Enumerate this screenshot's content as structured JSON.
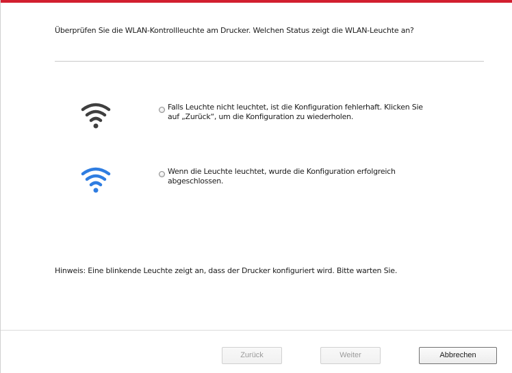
{
  "dialog": {
    "question": "Überprüfen Sie die WLAN-Kontrollleuchte am Drucker. Welchen Status zeigt die WLAN-Leuchte an?",
    "options": [
      {
        "icon": "wifi-off-icon",
        "icon_color": "#3f3f3f",
        "text": "Falls Leuchte nicht leuchtet, ist die Konfiguration fehlerhaft. Klicken Sie auf „Zurück“, um die Konfiguration zu wiederholen."
      },
      {
        "icon": "wifi-on-icon",
        "icon_color": "#2f7de1",
        "text": "Wenn die Leuchte leuchtet, wurde die Konfiguration erfolgreich abgeschlossen."
      }
    ],
    "hint": "Hinweis:  Eine blinkende Leuchte zeigt an, dass der Drucker konfiguriert wird.  Bitte warten Sie."
  },
  "buttons": {
    "back": "Zurück",
    "next": "Weiter",
    "cancel": "Abbrechen"
  },
  "colors": {
    "accent_bar": "#d21f2f"
  }
}
